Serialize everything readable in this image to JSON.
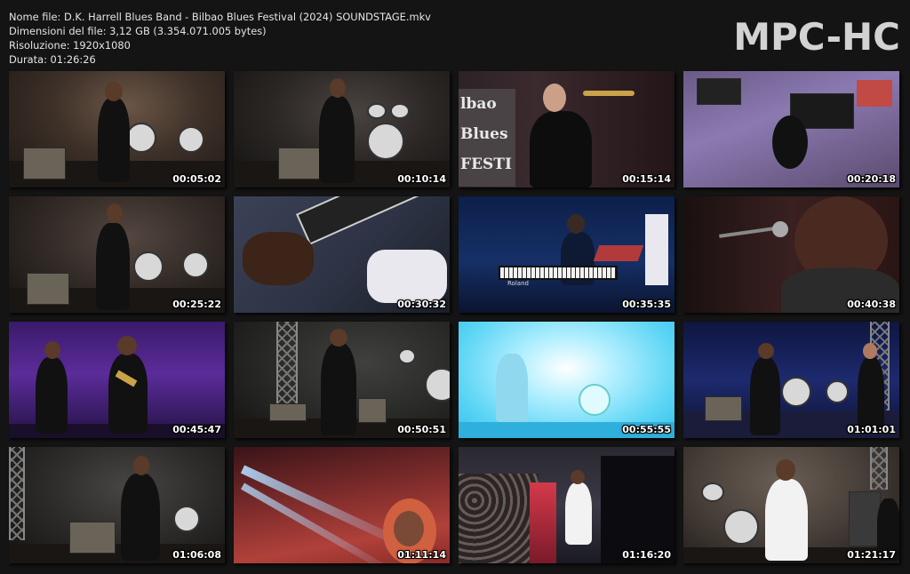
{
  "info": {
    "filename": "Nome file: D.K. Harrell Blues Band - Bilbao Blues Festival (2024) SOUNDSTAGE.mkv",
    "filesize": "Dimensioni del file: 3,12 GB (3.354.071.005 bytes)",
    "resolution": "Risoluzione: 1920x1080",
    "duration": "Durata: 01:26:26"
  },
  "logo": "MPC-HC",
  "thumbnails": [
    {
      "time": "00:05:02"
    },
    {
      "time": "00:10:14"
    },
    {
      "time": "00:15:14"
    },
    {
      "time": "00:20:18"
    },
    {
      "time": "00:25:22"
    },
    {
      "time": "00:30:32"
    },
    {
      "time": "00:35:35"
    },
    {
      "time": "00:40:38"
    },
    {
      "time": "00:45:47"
    },
    {
      "time": "00:50:51"
    },
    {
      "time": "00:55:55"
    },
    {
      "time": "01:01:01"
    },
    {
      "time": "01:06:08"
    },
    {
      "time": "01:11:14"
    },
    {
      "time": "01:16:20"
    },
    {
      "time": "01:21:17"
    }
  ],
  "banner_text": "lbao Blues FESTI",
  "keyboard_brand": "Roland"
}
